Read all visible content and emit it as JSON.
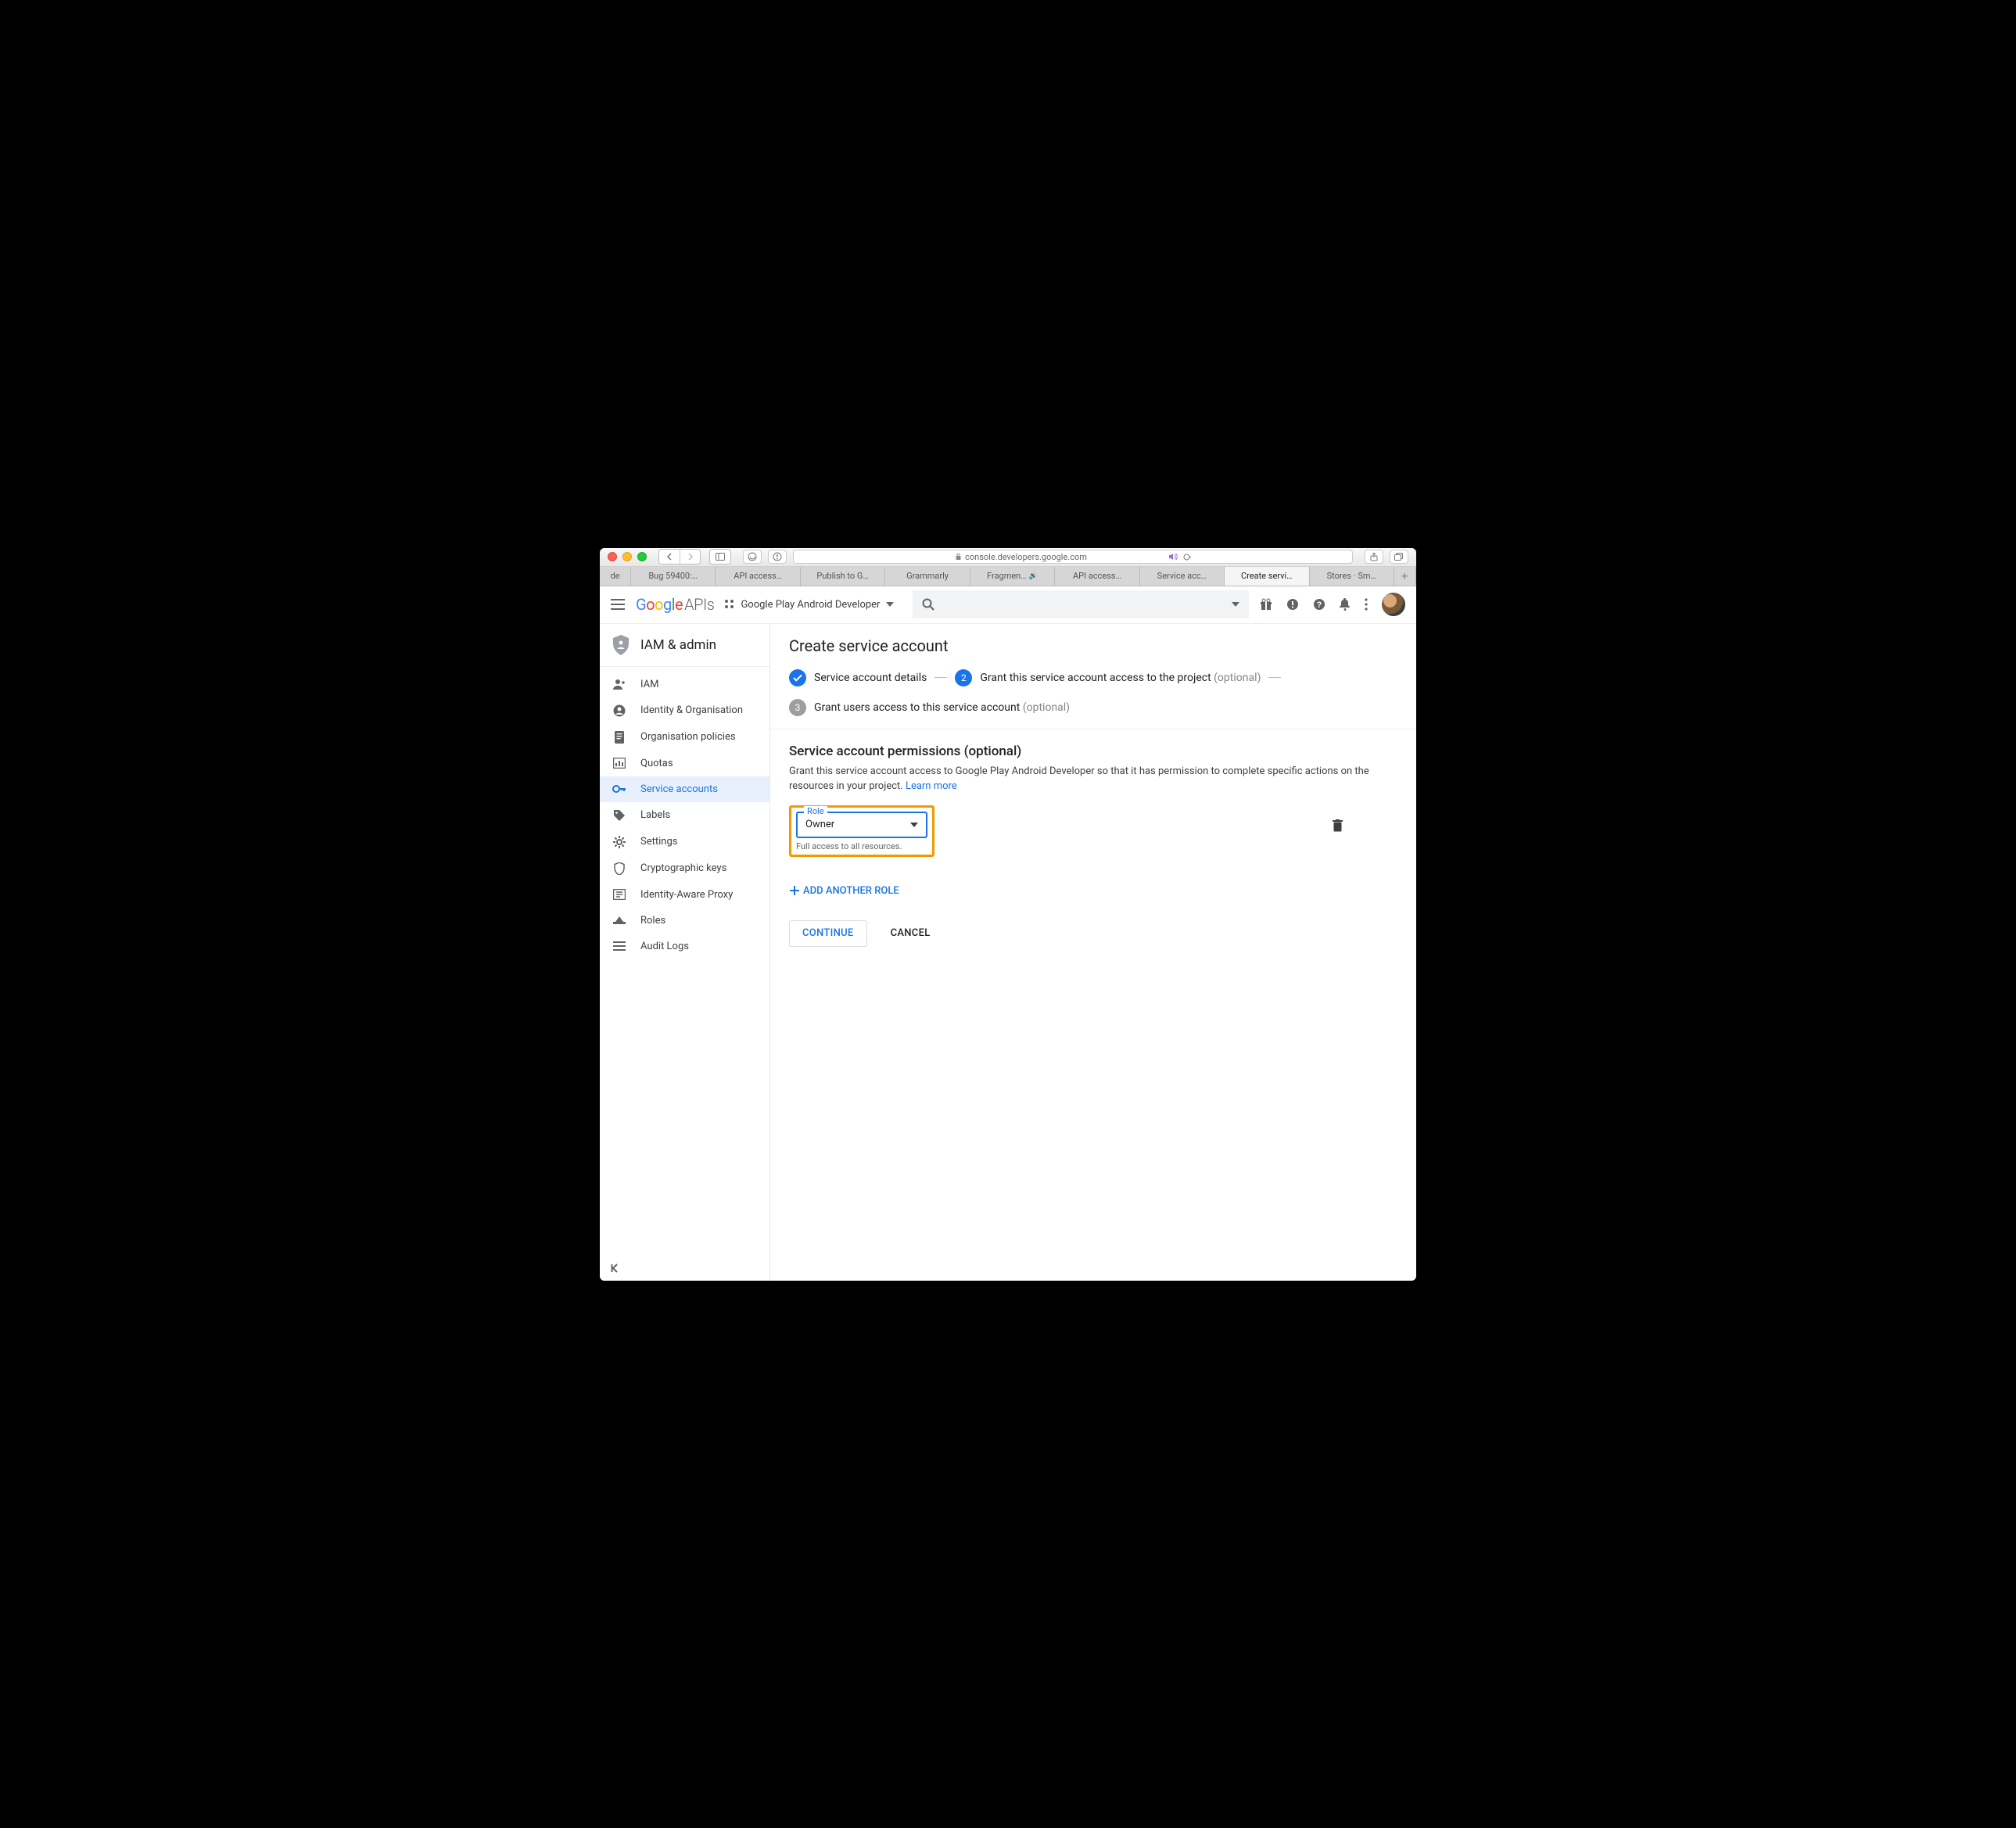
{
  "browser": {
    "url_host": "console.developers.google.com",
    "tabs": [
      {
        "label": "de",
        "audio": false
      },
      {
        "label": "Bug 59400:…",
        "audio": false
      },
      {
        "label": "API access…",
        "audio": false
      },
      {
        "label": "Publish to G…",
        "audio": false
      },
      {
        "label": "Grammarly",
        "audio": false
      },
      {
        "label": "Fragmen…",
        "audio": true
      },
      {
        "label": "API access…",
        "audio": false
      },
      {
        "label": "Service acc…",
        "audio": false
      },
      {
        "label": "Create servi…",
        "audio": false,
        "active": true
      },
      {
        "label": "Stores · Sm…",
        "audio": false
      }
    ]
  },
  "header": {
    "product": "APIs",
    "project_name": "Google Play Android Developer"
  },
  "sidebar": {
    "title": "IAM & admin",
    "items": [
      {
        "icon": "person-add",
        "label": "IAM"
      },
      {
        "icon": "person-circle",
        "label": "Identity & Organisation"
      },
      {
        "icon": "doc",
        "label": "Organisation policies"
      },
      {
        "icon": "quota",
        "label": "Quotas"
      },
      {
        "icon": "key",
        "label": "Service accounts"
      },
      {
        "icon": "tag",
        "label": "Labels"
      },
      {
        "icon": "gear",
        "label": "Settings"
      },
      {
        "icon": "shield",
        "label": "Cryptographic keys"
      },
      {
        "icon": "iap",
        "label": "Identity-Aware Proxy"
      },
      {
        "icon": "roles",
        "label": "Roles"
      },
      {
        "icon": "audit",
        "label": "Audit Logs"
      }
    ]
  },
  "main": {
    "page_title": "Create service account",
    "steps": {
      "s1": "Service account details",
      "s2_pre": "Grant this service account access to the project",
      "s3_pre": "Grant users access to this service account",
      "optional": "(optional)"
    },
    "section_title": "Service account permissions (optional)",
    "section_body": "Grant this service account access to Google Play Android Developer so that it has permission to complete specific actions on the resources in your project.",
    "learn_more": "Learn more",
    "role_label": "Role",
    "role_value": "Owner",
    "role_hint": "Full access to all resources.",
    "add_role": "ADD ANOTHER ROLE",
    "continue": "CONTINUE",
    "cancel": "CANCEL"
  }
}
